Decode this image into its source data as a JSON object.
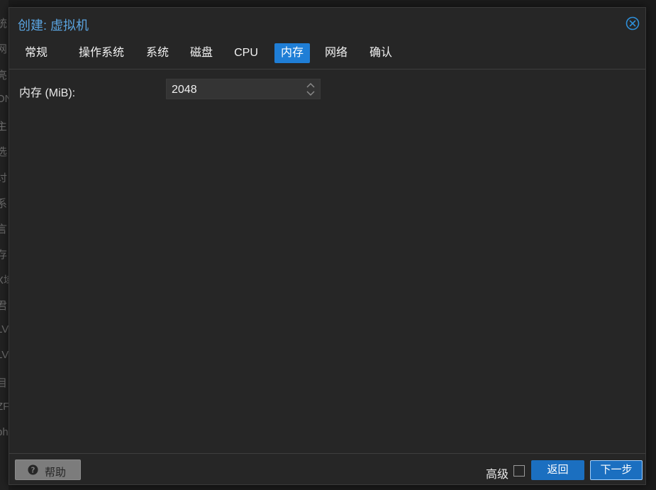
{
  "background_sidebar_fragments": [
    "统",
    "网",
    "亮",
    "ON",
    "主",
    "选",
    "讨",
    "系",
    "言",
    "存",
    "X域",
    "君",
    "LV",
    "LV",
    "目",
    "ZF",
    "ph",
    "."
  ],
  "dialog": {
    "title": "创建: 虚拟机",
    "close_icon": "circle-x-icon"
  },
  "tabs": [
    {
      "label": "常规",
      "active": false
    },
    {
      "label": "操作系统",
      "active": false
    },
    {
      "label": "系统",
      "active": false
    },
    {
      "label": "磁盘",
      "active": false
    },
    {
      "label": "CPU",
      "active": false
    },
    {
      "label": "内存",
      "active": true
    },
    {
      "label": "网络",
      "active": false
    },
    {
      "label": "确认",
      "active": false
    }
  ],
  "memory": {
    "label": "内存 (MiB):",
    "value": "2048"
  },
  "footer": {
    "help_label": "帮助",
    "help_icon": "question-circle-icon",
    "advanced_label": "高级",
    "advanced_checked": false,
    "back_label": "返回",
    "next_label": "下一步"
  },
  "colors": {
    "accent": "#1f7ed6",
    "title": "#5aa4e0",
    "dialog_bg": "#262626"
  }
}
